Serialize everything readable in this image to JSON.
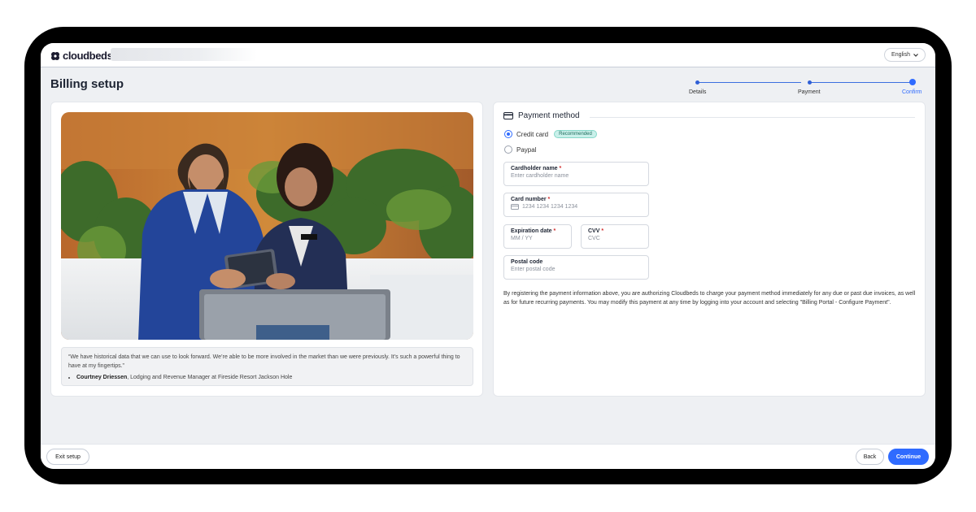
{
  "app": {
    "logo_text": "cloudbeds",
    "language": "English"
  },
  "page": {
    "title": "Billing setup"
  },
  "stepper": {
    "steps": [
      {
        "label": "Details",
        "active": false
      },
      {
        "label": "Payment",
        "active": false
      },
      {
        "label": "Confirm",
        "active": true
      }
    ]
  },
  "testimonial": {
    "quote": "“We have historical data that we can use to look forward. We’re able to be more involved in the market than we were previously. It’s such a powerful thing to have at my fingertips.”",
    "author": "Courtney Driessen",
    "role": ", Lodging and Revenue Manager at Fireside Resort Jackson Hole"
  },
  "payment": {
    "section_title": "Payment method",
    "options": [
      {
        "label": "Credit card",
        "selected": true,
        "badge": "Recommended"
      },
      {
        "label": "Paypal",
        "selected": false
      }
    ],
    "fields": {
      "cardholder": {
        "label": "Cardholder name",
        "required": "*",
        "placeholder": "Enter cardholder name"
      },
      "card_number": {
        "label": "Card number",
        "required": "*",
        "placeholder": "1234 1234 1234 1234"
      },
      "expiration": {
        "label": "Expiration date",
        "required": "*",
        "placeholder": "MM / YY"
      },
      "cvv": {
        "label": "CVV",
        "required": "*",
        "placeholder": "CVC"
      },
      "postal": {
        "label": "Postal code",
        "placeholder": "Enter postal code"
      }
    },
    "legal": "By registering the payment information above, you are authorizing Cloudbeds to charge your payment method immediately for any due or past due invoices, as well as for future recurring payments. You may modify this payment at any time by logging into your account and selecting \"Billing Portal - Configure Payment\"."
  },
  "footer": {
    "exit_label": "Exit setup",
    "back_label": "Back",
    "continue_label": "Continue"
  },
  "colors": {
    "accent": "#2f6bff",
    "badge_bg": "#c9f0ea",
    "background": "#eef0f3"
  }
}
